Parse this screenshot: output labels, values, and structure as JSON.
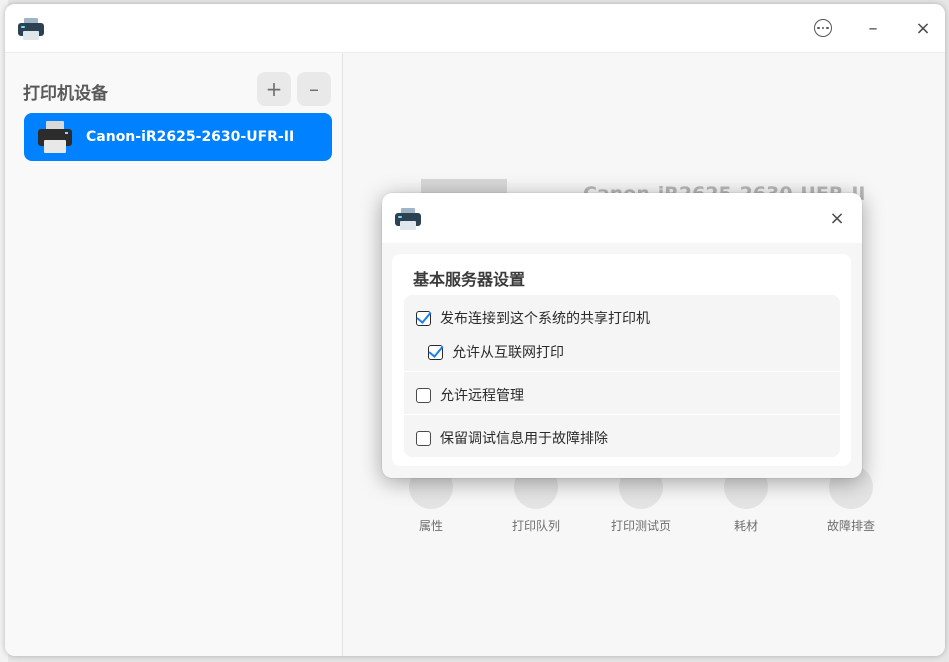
{
  "window": {
    "app_icon": "printer-icon",
    "controls": {
      "menu_icon": "more-circle-icon",
      "minimize_icon": "minimize-icon",
      "close_icon": "close-icon",
      "minimize_glyph": "–",
      "close_glyph": "×"
    }
  },
  "sidebar": {
    "title": "打印机设备",
    "add_glyph": "+",
    "remove_glyph": "–",
    "printers": [
      {
        "name": "Canon-iR2625-2630-UFR-II",
        "icon": "printer-icon",
        "selected": true
      }
    ]
  },
  "main": {
    "printer_name": "Canon-iR2625-2630-UFR-II",
    "name_tail": "II",
    "actions": [
      {
        "label": "属性"
      },
      {
        "label": "打印队列"
      },
      {
        "label": "打印测试页"
      },
      {
        "label": "耗材"
      },
      {
        "label": "故障排查"
      }
    ]
  },
  "dialog": {
    "icon": "printer-icon",
    "close_glyph": "×",
    "title": "基本服务器设置",
    "options": [
      {
        "label": "发布连接到这个系统的共享打印机",
        "checked": true
      },
      {
        "label": "允许从互联网打印",
        "checked": true
      },
      {
        "label": "允许远程管理",
        "checked": false
      },
      {
        "label": "保留调试信息用于故障排除",
        "checked": false
      }
    ]
  },
  "colors": {
    "accent": "#0081ff",
    "check": "#1c7ff0"
  }
}
